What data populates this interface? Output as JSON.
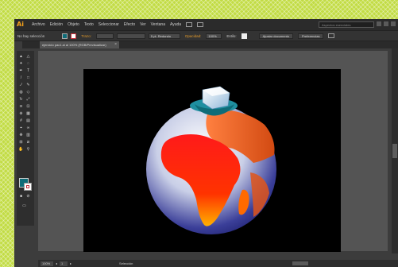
{
  "app": {
    "logo": "Ai",
    "menu": [
      "Archivo",
      "Edición",
      "Objeto",
      "Texto",
      "Seleccionar",
      "Efecto",
      "Ver",
      "Ventana",
      "Ayuda"
    ],
    "workspace": "Aspectos esenciales"
  },
  "controlbar": {
    "selection_label": "No hay selección",
    "stroke_label": "Trazo:",
    "brush": "5 pt. Redondo",
    "opacity_label": "Opacidad:",
    "opacity_value": "100%",
    "style_label": "Estilo:",
    "document_setup": "Ajustar documento",
    "preferences": "Preferencias"
  },
  "document": {
    "tab_title": "ejercicio pac1.ai al 100% (RGB/Previsualizar)"
  },
  "status": {
    "zoom": "100%",
    "page": "1",
    "info": "Selección"
  },
  "colors": {
    "fill": "#0f6c78",
    "accent": "#f7a21b",
    "artboard": "#000000"
  }
}
